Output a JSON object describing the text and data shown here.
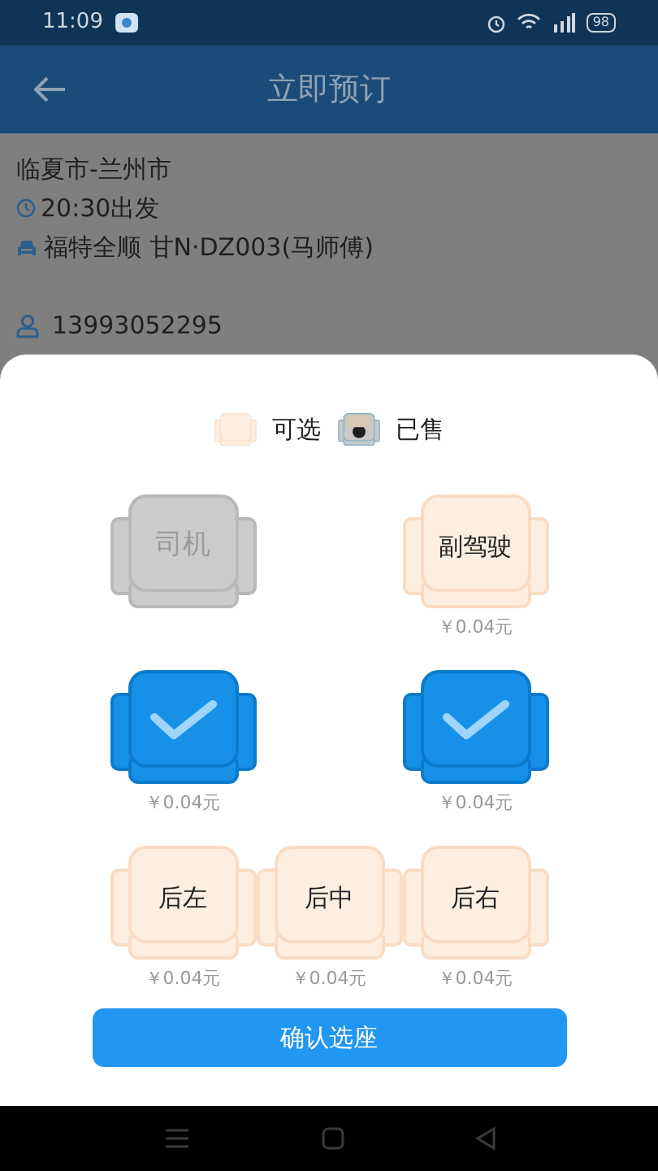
{
  "status_bar": {
    "time": "11:09",
    "battery": "98"
  },
  "app_bar": {
    "title": "立即预订"
  },
  "trip": {
    "route": "临夏市-兰州市",
    "departure": "20:30出发",
    "vehicle": "福特全顺 甘N·DZ003(马师傅)",
    "phone": "13993052295"
  },
  "legend": [
    {
      "kind": "available",
      "label": "可选"
    },
    {
      "kind": "sold",
      "label": "已售"
    }
  ],
  "seat_rows": [
    {
      "seats": [
        {
          "kind": "seat",
          "disabled": true,
          "selected": false,
          "label": "司机"
        },
        {
          "kind": "gap"
        },
        {
          "kind": "seat",
          "disabled": false,
          "selected": false,
          "label": "副驾驶",
          "price": "￥0.04元"
        }
      ]
    },
    {
      "seats": [
        {
          "kind": "seat",
          "disabled": false,
          "selected": true,
          "price": "￥0.04元"
        },
        {
          "kind": "gap"
        },
        {
          "kind": "seat",
          "disabled": false,
          "selected": true,
          "price": "￥0.04元"
        }
      ]
    },
    {
      "seats": [
        {
          "kind": "seat",
          "disabled": false,
          "selected": false,
          "label": "后左",
          "price": "￥0.04元"
        },
        {
          "kind": "seat",
          "disabled": false,
          "selected": false,
          "label": "后中",
          "price": "￥0.04元"
        },
        {
          "kind": "seat",
          "disabled": false,
          "selected": false,
          "label": "后右",
          "price": "￥0.04元"
        }
      ]
    }
  ],
  "confirm_button": "确认选座"
}
